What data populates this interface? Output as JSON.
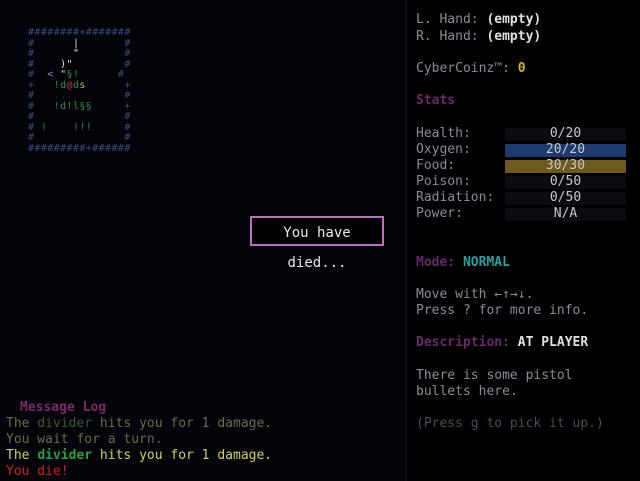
{
  "dialog": {
    "text": "You have died..."
  },
  "map": {
    "rows": [
      "########+#######",
      "#      |       #",
      "#      \"       #",
      "#    )\"        #",
      "#  < \"§!      #",
      "+   !d@ds      +",
      "#   ...        #",
      "#   !d!l§§     +",
      "#              #",
      "# !    !!!     #",
      "#              #",
      "#########+######"
    ]
  },
  "sidebar": {
    "left_hand_label": "L. Hand:",
    "left_hand_value": "(empty)",
    "right_hand_label": "R. Hand:",
    "right_hand_value": "(empty)",
    "coinz_label": "CyberCoinz™:",
    "coinz_value": "0",
    "stats_heading": "Stats",
    "stats": [
      {
        "label": "Health:",
        "value": "0/20",
        "fill": 0.0,
        "color": "#2a2a2a"
      },
      {
        "label": "Oxygen:",
        "value": "20/20",
        "fill": 1.0,
        "color": "#1e3a6e"
      },
      {
        "label": "Food:",
        "value": "30/30",
        "fill": 1.0,
        "color": "#6e5a1e"
      },
      {
        "label": "Poison:",
        "value": "0/50",
        "fill": 0.0,
        "color": "#2a2a2a"
      },
      {
        "label": "Radiation:",
        "value": "0/50",
        "fill": 0.0,
        "color": "#2a2a2a"
      },
      {
        "label": "Power:",
        "value": "N/A",
        "fill": 0.0,
        "color": "#2a2a2a"
      }
    ],
    "mode_label": "Mode:",
    "mode_value": "NORMAL",
    "help_line1": "Move with ←↑→↓.",
    "help_line2": "Press ? for more info.",
    "description_label": "Description:",
    "description_value": "AT PLAYER",
    "desc_line1": "There is some pistol",
    "desc_line2": "bullets here.",
    "pickup_hint": "(Press g to pick it up.)"
  },
  "log": {
    "title": "Message Log",
    "messages": [
      {
        "pre": "The ",
        "entity": "divider",
        "post": " hits you for 1 damage."
      },
      {
        "text": "You wait for a turn."
      },
      {
        "pre": "The ",
        "entity": "divider",
        "post": " hits you for 1 damage."
      },
      {
        "text": "You die!"
      }
    ]
  }
}
